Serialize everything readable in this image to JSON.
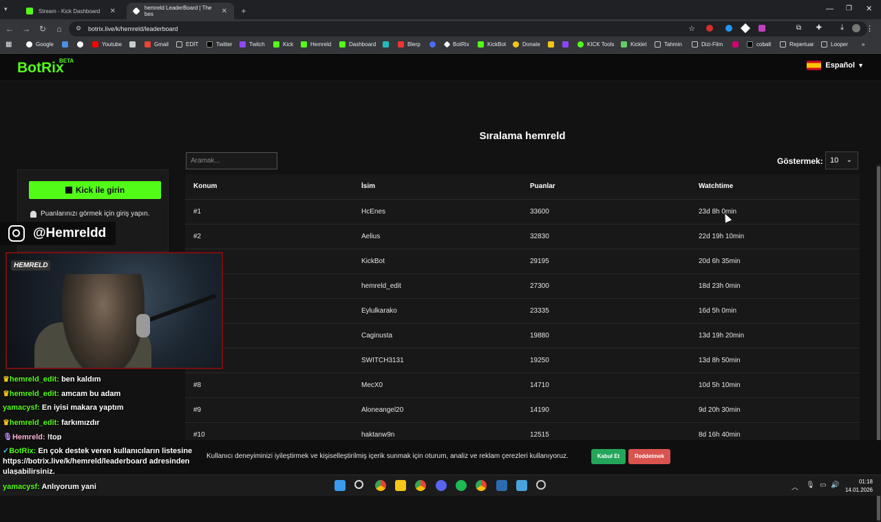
{
  "browser": {
    "tabs": [
      {
        "label": "Stream - Kick Dashboard",
        "active": false
      },
      {
        "label": "hemreld LeaderBoard | The bes",
        "active": true
      }
    ],
    "new_tab": "+",
    "url": "botrix.live/k/hemreld/leaderboard",
    "bookmarks": [
      "Google",
      "Youtube",
      "Gmail",
      "EDİT",
      "Twitter",
      "Twitch",
      "Kick",
      "Hemreld",
      "Dashboard",
      "Blerp",
      "BotRix",
      "KickBot",
      "Donate",
      "KICK Tools",
      "Kicklet",
      "Tahmin",
      "Dizi-Film",
      "cobalt",
      "Repertuar",
      "Looper"
    ]
  },
  "site": {
    "logo": "BotRix",
    "beta": "BETA",
    "language": "Español"
  },
  "login": {
    "button": "Kick ile girin",
    "hint": "Puanlarınızı görmek için giriş yapın."
  },
  "leaderboard": {
    "title": "Sıralama hemreld",
    "search_placeholder": "Aramak...",
    "show_label": "Göstermek:",
    "show_value": "10",
    "columns": [
      "Konum",
      "İsim",
      "Puanlar",
      "Watchtime"
    ],
    "rows": [
      {
        "pos": "#1",
        "name": "HcEnes",
        "points": "33600",
        "watchtime": "23d 8h 0min"
      },
      {
        "pos": "#2",
        "name": "Aelius",
        "points": "32830",
        "watchtime": "22d 19h 10min"
      },
      {
        "pos": "",
        "name": "KickBot",
        "points": "29195",
        "watchtime": "20d 6h 35min"
      },
      {
        "pos": "",
        "name": "hemreld_edit",
        "points": "27300",
        "watchtime": "18d 23h 0min"
      },
      {
        "pos": "",
        "name": "Eylulkarako",
        "points": "23335",
        "watchtime": "16d 5h 0min"
      },
      {
        "pos": "",
        "name": "Caginusta",
        "points": "19880",
        "watchtime": "13d 19h 20min"
      },
      {
        "pos": "",
        "name": "SWITCH3131",
        "points": "19250",
        "watchtime": "13d 8h 50min"
      },
      {
        "pos": "#8",
        "name": "MecX0",
        "points": "14710",
        "watchtime": "10d 5h 10min"
      },
      {
        "pos": "#9",
        "name": "Aloneangel20",
        "points": "14190",
        "watchtime": "9d 20h 30min"
      },
      {
        "pos": "#10",
        "name": "haktanw9n",
        "points": "12515",
        "watchtime": "8d 16h 40min"
      }
    ]
  },
  "stream_overlay": {
    "instagram": "@Hemreldd",
    "cam_logo": "HEMRELD",
    "chat": [
      {
        "user": "hemreld_edit:",
        "msg": "ben kaldım"
      },
      {
        "user": "hemreld_edit:",
        "msg": "amcam bu adam"
      },
      {
        "user": "yamacysf:",
        "msg": "En iyisi makara yaptım"
      },
      {
        "user": "hemreld_edit:",
        "msg": "farkımızdır"
      },
      {
        "user": "Hemreld:",
        "msg": "!top"
      }
    ],
    "bot_user": "BotRix:",
    "bot_msg": "En çok destek veren kullanıcıların listesine https://botrix.live/k/hemreld/leaderboard adresinden ulaşabilirsiniz.",
    "last_user": "yamacysf:",
    "last_msg": "Anlıyorum yani"
  },
  "cookie": {
    "text": "Kullanıcı deneyiminizi iyileştirmek ve kişiselleştirilmiş içerik sunmak için oturum, analiz ve reklam çerezleri kullanıyoruz.",
    "accept": "Kabul Et",
    "reject": "Reddetmek"
  },
  "taskbar": {
    "time": "01:18",
    "date": "14.01.2026"
  },
  "colors": {
    "accent": "#53fc18",
    "background": "#121212",
    "accept": "#24a65a",
    "reject": "#d9534f"
  }
}
